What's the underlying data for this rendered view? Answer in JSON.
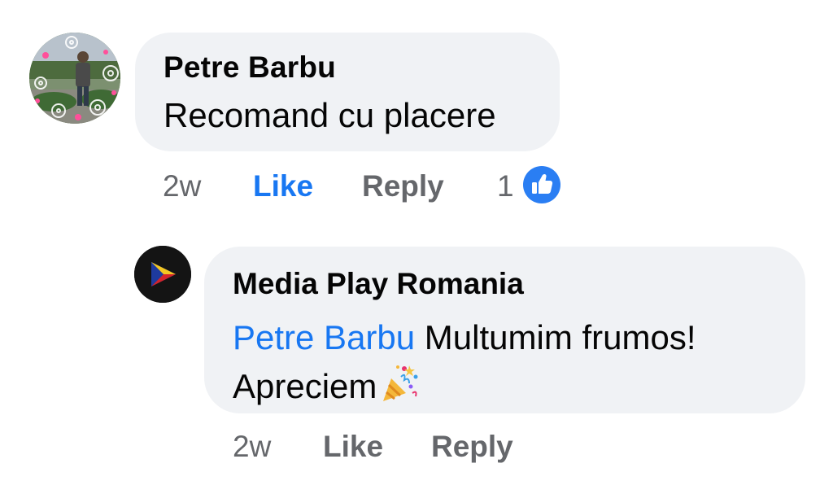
{
  "comment": {
    "author": "Petre Barbu",
    "text": "Recomand cu placere",
    "actions": {
      "time": "2w",
      "like_label": "Like",
      "reply_label": "Reply",
      "reaction_count": "1",
      "reaction_icon": "thumbs-up-icon"
    },
    "avatar": "user-avatar-photo",
    "colors": {
      "like_active": "#1877f2",
      "bubble": "#f0f2f5",
      "meta": "#65676b"
    }
  },
  "reply": {
    "author": "Media Play Romania",
    "mention": "Petre Barbu",
    "text_line1_rest": " Multumim frumos!",
    "text_line2": "Apreciem",
    "emoji": "party-popper-icon",
    "avatar": "media-play-logo",
    "actions": {
      "time": "2w",
      "like_label": "Like",
      "reply_label": "Reply"
    }
  }
}
